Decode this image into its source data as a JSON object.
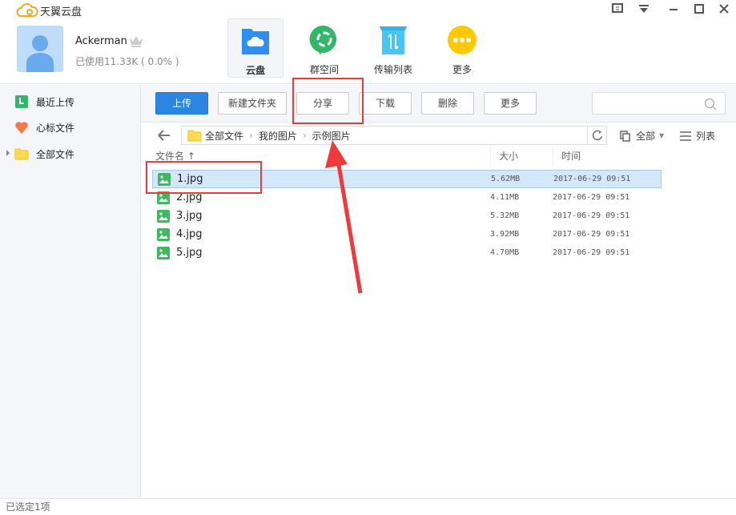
{
  "app": {
    "title": "天翼云盘"
  },
  "user": {
    "name": "Ackerman",
    "usage": "已使用11.33K ( 0.0% )"
  },
  "nav": [
    {
      "label": "云盘",
      "icon": "cloud-folder-icon"
    },
    {
      "label": "群空间",
      "icon": "group-space-icon"
    },
    {
      "label": "传输列表",
      "icon": "transfer-list-icon"
    },
    {
      "label": "更多",
      "icon": "more-icon"
    }
  ],
  "sidebar": {
    "items": [
      {
        "label": "最近上传",
        "icon": "recent-upload-icon"
      },
      {
        "label": "心标文件",
        "icon": "heart-icon"
      },
      {
        "label": "全部文件",
        "icon": "folder-icon"
      }
    ]
  },
  "toolbar": {
    "upload": "上传",
    "new_folder": "新建文件夹",
    "share": "分享",
    "download": "下载",
    "delete": "删除",
    "more": "更多",
    "search_placeholder": ""
  },
  "breadcrumb": [
    "全部文件",
    "我的图片",
    "示例图片"
  ],
  "filter": {
    "all": "全部",
    "view": "列表"
  },
  "columns": {
    "name": "文件名 ↑",
    "size": "大小",
    "time": "时间"
  },
  "files": [
    {
      "name": "1.jpg",
      "size": "5.62MB",
      "time": "2017-06-29 09:51"
    },
    {
      "name": "2.jpg",
      "size": "4.11MB",
      "time": "2017-06-29 09:51"
    },
    {
      "name": "3.jpg",
      "size": "5.32MB",
      "time": "2017-06-29 09:51"
    },
    {
      "name": "4.jpg",
      "size": "3.92MB",
      "time": "2017-06-29 09:51"
    },
    {
      "name": "5.jpg",
      "size": "4.70MB",
      "time": "2017-06-29 09:51"
    }
  ],
  "status": "已选定1项",
  "colors": {
    "accent": "#2b86e3",
    "annotation": "#f03a3a",
    "selected_row": "#d5e7fb"
  }
}
